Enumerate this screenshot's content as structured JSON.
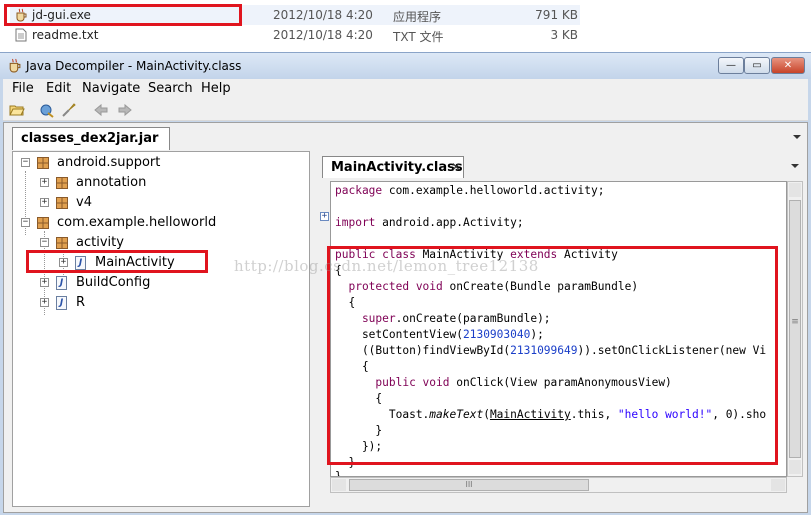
{
  "explorer": {
    "files": [
      {
        "name": "jd-gui.exe",
        "date": "2012/10/18 4:20",
        "type": "应用程序",
        "size": "791 KB"
      },
      {
        "name": "readme.txt",
        "date": "2012/10/18 4:20",
        "type": "TXT 文件",
        "size": "3 KB"
      }
    ]
  },
  "window": {
    "title": "Java Decompiler - MainActivity.class",
    "buttons": {
      "minimize": "—",
      "maximize": "▭",
      "close": "✕"
    }
  },
  "menu": [
    "File",
    "Edit",
    "Navigate",
    "Search",
    "Help"
  ],
  "toolbar": [
    "open-folder-icon",
    "open-type-icon",
    "search-icon",
    "back-arrow-icon",
    "forward-arrow-icon"
  ],
  "outer_tab": {
    "label": "classes_dex2jar.jar"
  },
  "tree": {
    "n0": "android.support",
    "n1": "annotation",
    "n2": "v4",
    "n3": "com.example.helloworld",
    "n4": "activity",
    "n5": "MainActivity",
    "n6": "BuildConfig",
    "n7": "R",
    "expanders": {
      "collapsed": "+",
      "expanded": "−"
    },
    "file_icon_letter": "J"
  },
  "editor": {
    "tab_label": "MainActivity.class",
    "tab_close": "✕",
    "fold_marker": "+",
    "code": {
      "l1a": "package",
      "l1b": " com.example.helloworld.activity;",
      "l2a": "import",
      "l2b": " android.app.Activity;",
      "l3a": "public class",
      "l3b": " MainActivity ",
      "l3c": "extends",
      "l3d": " Activity",
      "l4": "{",
      "l5a": "  protected void",
      "l5b": " onCreate(Bundle paramBundle)",
      "l6": "  {",
      "l7a": "    super",
      "l7b": ".onCreate(paramBundle);",
      "l8a": "    setContentView(",
      "l8b": "2130903040",
      "l8c": ");",
      "l9a": "    ((Button)findViewById(",
      "l9b": "2131099649",
      "l9c": ")).setOnClickListener(new Vi",
      "l10": "    {",
      "l11a": "      public void",
      "l11b": " onClick(View paramAnonymousView)",
      "l12": "      {",
      "l13a": "        Toast.",
      "l13b": "makeText",
      "l13c": "(",
      "l13d": "MainActivity",
      "l13e": ".this, ",
      "l13f": "\"hello world!\"",
      "l13g": ", 0).sho",
      "l14": "      }",
      "l15": "    });",
      "l16": "  }",
      "l17": "}"
    },
    "hscroll_grip": "III",
    "vscroll_grip": "≡"
  },
  "watermark": "http://blog.csdn.net/lemon_tree12138",
  "colors": {
    "highlight_box": "#e0141e",
    "keyword": "#7f0055",
    "number": "#1a3ec8",
    "string": "#2a00ff"
  }
}
